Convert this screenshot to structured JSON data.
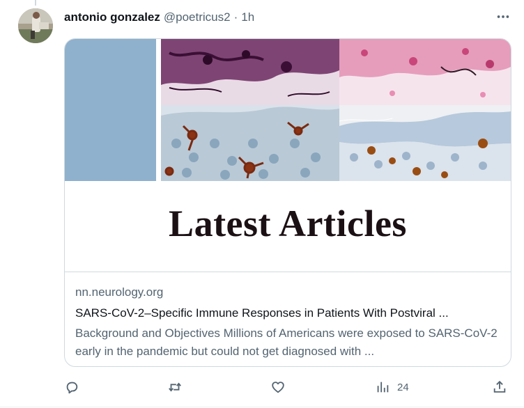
{
  "tweet": {
    "author_name": "antonio gonzalez",
    "handle": "@poetricus2",
    "separator": "·",
    "time": "1h",
    "more_icon": "more-horizontal-icon"
  },
  "card": {
    "banner_text": "Latest Articles",
    "domain": "nn.neurology.org",
    "title": "SARS-CoV-2–Specific Immune Responses in Patients With Postviral ...",
    "description": "Background and Objectives Millions of Americans were exposed to SARS-CoV-2 early in the pandemic but could not get diagnosed with ..."
  },
  "actions": {
    "reply_icon": "reply-icon",
    "retweet_icon": "retweet-icon",
    "like_icon": "heart-icon",
    "views_icon": "analytics-icon",
    "views_count": "24",
    "share_icon": "share-icon"
  },
  "colors": {
    "accent_block": "#8fb1cd",
    "text_primary": "#0f1419",
    "text_secondary": "#536471",
    "border": "#cfd9de"
  }
}
